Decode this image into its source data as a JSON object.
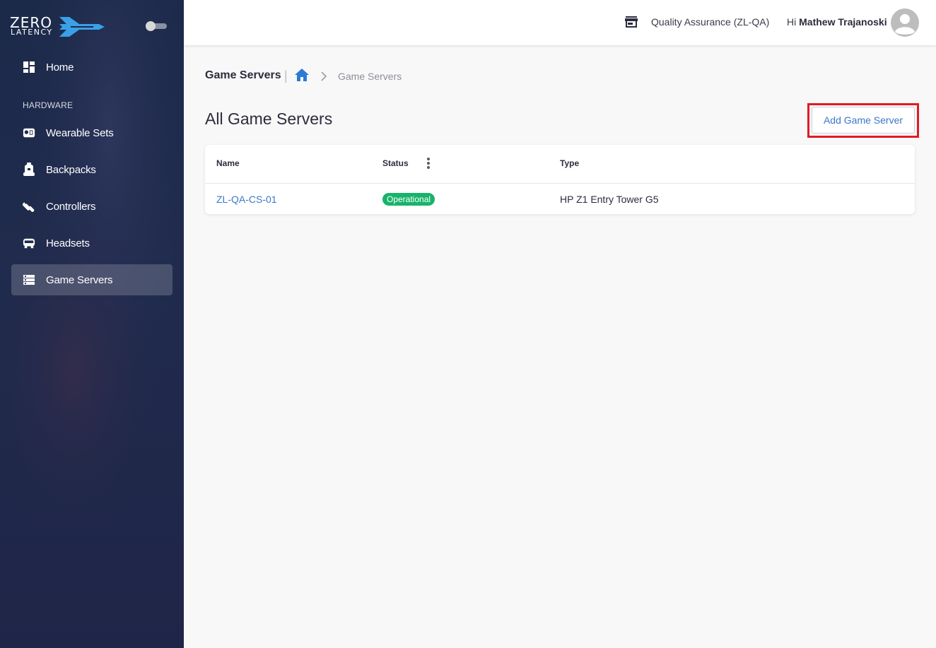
{
  "brand": {
    "line1": "ZERO",
    "line2": "LATENCY"
  },
  "sidebar": {
    "items": [
      {
        "label": "Home",
        "icon": "dashboard-icon"
      },
      {
        "label": "Wearable Sets",
        "icon": "wearable-sets-icon"
      },
      {
        "label": "Backpacks",
        "icon": "backpack-icon"
      },
      {
        "label": "Controllers",
        "icon": "controller-icon"
      },
      {
        "label": "Headsets",
        "icon": "headset-icon"
      },
      {
        "label": "Game Servers",
        "icon": "server-icon",
        "active": true
      }
    ],
    "section_label": "HARDWARE"
  },
  "topbar": {
    "org_icon": "store-icon",
    "org_name": "Quality Assurance (ZL-QA)",
    "greeting_prefix": "Hi",
    "user_name": "Mathew Trajanoski",
    "avatar_icon": "account-circle-icon"
  },
  "breadcrumb": {
    "title": "Game Servers",
    "separator": "|",
    "home_icon": "home-icon",
    "current": "Game Servers"
  },
  "page": {
    "title": "All Game Servers",
    "add_button_label": "Add Game Server"
  },
  "table": {
    "columns": [
      "Name",
      "Status",
      "Type"
    ],
    "rows": [
      {
        "name": "ZL-QA-CS-01",
        "status": "Operational",
        "type": "HP Z1 Entry Tower G5"
      }
    ]
  },
  "colors": {
    "sidebar_bg": "#1f2a4c",
    "accent_blue": "#3b77c9",
    "status_operational": "#18b36b",
    "highlight_red": "#e01b24"
  }
}
